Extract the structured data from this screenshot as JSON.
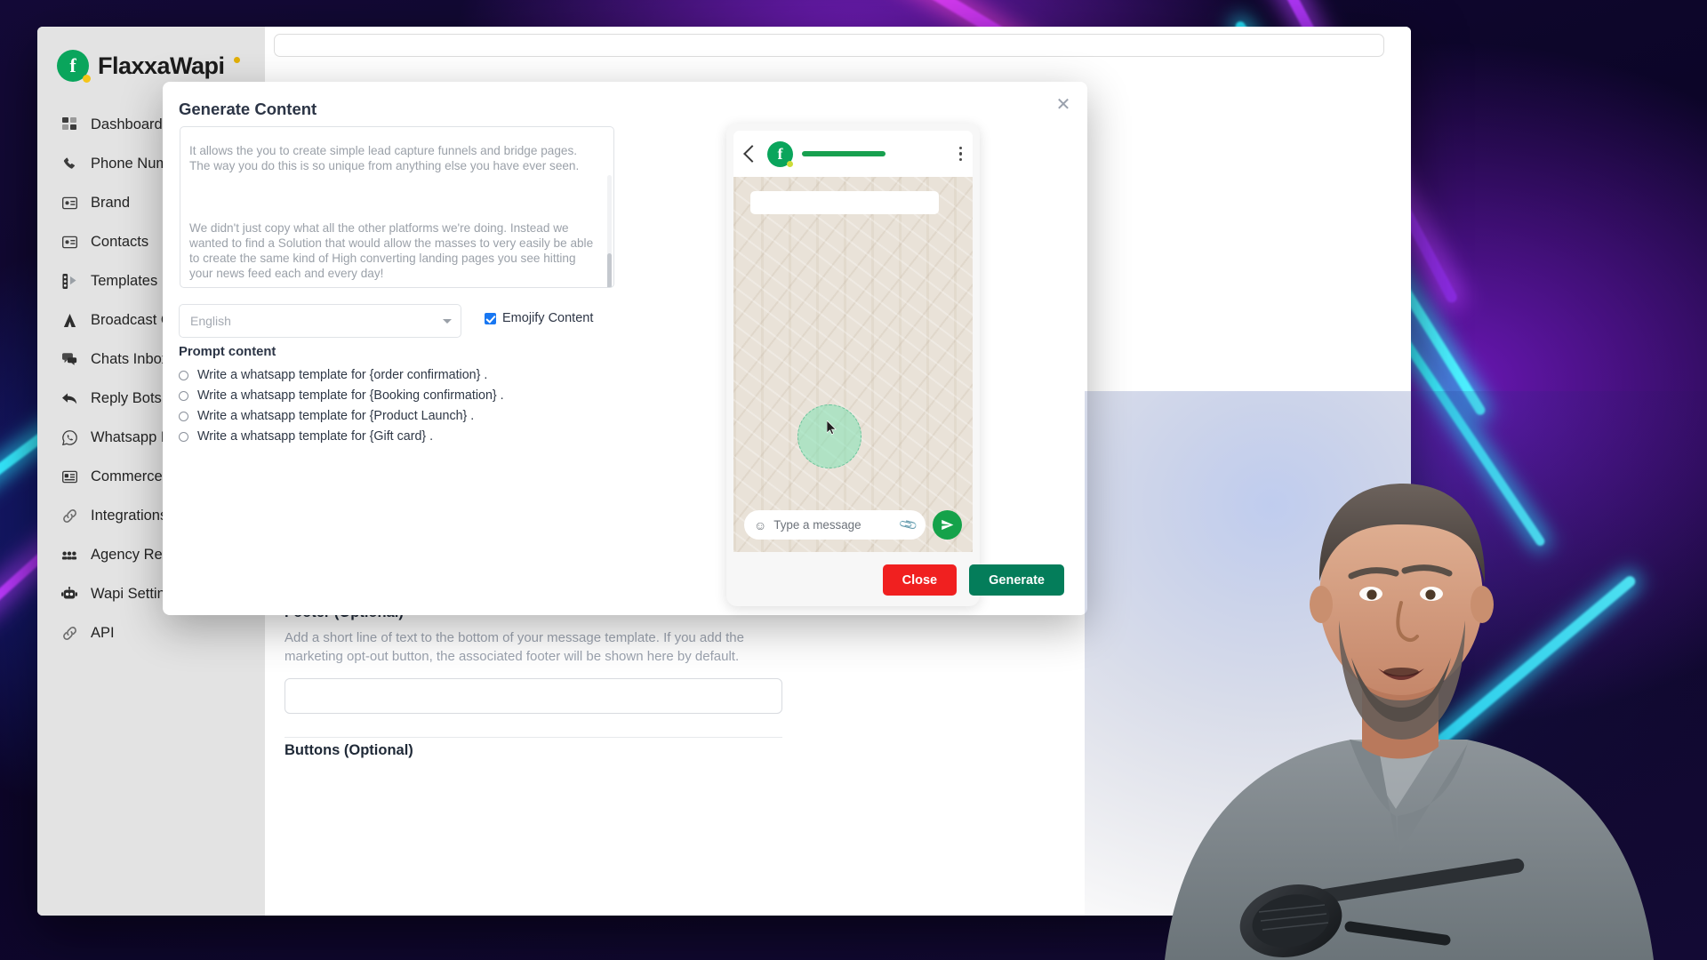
{
  "app": {
    "brand_name": "FlaxxaWapi",
    "brand_icon": "whatsapp-facebook-logo"
  },
  "sidebar": {
    "items": [
      {
        "label": "Dashboard",
        "icon": "grid-icon"
      },
      {
        "label": "Phone Numb",
        "icon": "phone-icon"
      },
      {
        "label": "Brand",
        "icon": "card-icon"
      },
      {
        "label": "Contacts",
        "icon": "contact-card-icon"
      },
      {
        "label": "Templates",
        "icon": "templates-icon"
      },
      {
        "label": "Broadcast Ca",
        "icon": "broadcast-icon"
      },
      {
        "label": "Chats Inbox",
        "icon": "chat-icon"
      },
      {
        "label": "Reply Bots",
        "icon": "reply-arrow-icon"
      },
      {
        "label": "Whatsapp Fl",
        "icon": "whatsapp-icon"
      },
      {
        "label": "Commerce C",
        "icon": "commerce-card-icon"
      },
      {
        "label": "Integrations",
        "icon": "link-icon"
      },
      {
        "label": "Agency Rese",
        "icon": "users-icon"
      },
      {
        "label": "Wapi Setting",
        "icon": "robot-icon"
      },
      {
        "label": "API",
        "icon": "link-icon"
      }
    ]
  },
  "background_form": {
    "footer_label": "Footer (Optional)",
    "footer_desc": "Add a short line of text to the bottom of your message template. If you add the marketing opt-out button, the associated footer will be shown here by default.",
    "footer_value": "",
    "buttons_label": "Buttons (Optional)"
  },
  "modal": {
    "title": "Generate Content",
    "close_icon": "close-icon",
    "textarea": {
      "paragraph_1": "It allows the you to create simple lead capture funnels and bridge pages. The way you do this is so unique from anything else you have ever seen.",
      "paragraph_2": "We didn't just copy what all the other platforms we're doing. Instead we wanted to find a Solution that would allow the masses to very easily be able to create the same kind of High converting landing pages you see hitting your news feed each and every day!"
    },
    "language": {
      "value": "English",
      "caret_icon": "chevron-down-icon"
    },
    "emojify": {
      "label": "Emojify Content",
      "checked": true,
      "accent_color": "#1877f2"
    },
    "prompt_content": {
      "title": "Prompt content",
      "options": [
        "Write a whatsapp template for {order confirmation} .",
        "Write a whatsapp template for {Booking confirmation} .",
        "Write a whatsapp template for {Product Launch} .",
        "Write a whatsapp template for {Gift card} ."
      ]
    },
    "footer_buttons": {
      "close": "Close",
      "generate": "Generate",
      "close_color": "#f02020",
      "generate_color": "#047d5a"
    }
  },
  "phone_preview": {
    "back_icon": "back-chevron-icon",
    "avatar_icon": "whatsapp-facebook-avatar",
    "menu_icon": "more-vertical-icon",
    "message_placeholder": "Type a message",
    "emoji_icon": "smiley-icon",
    "attach_icon": "paperclip-icon",
    "send_icon": "send-icon",
    "send_color": "#15a24a",
    "header_bar_color": "#17a04f"
  }
}
